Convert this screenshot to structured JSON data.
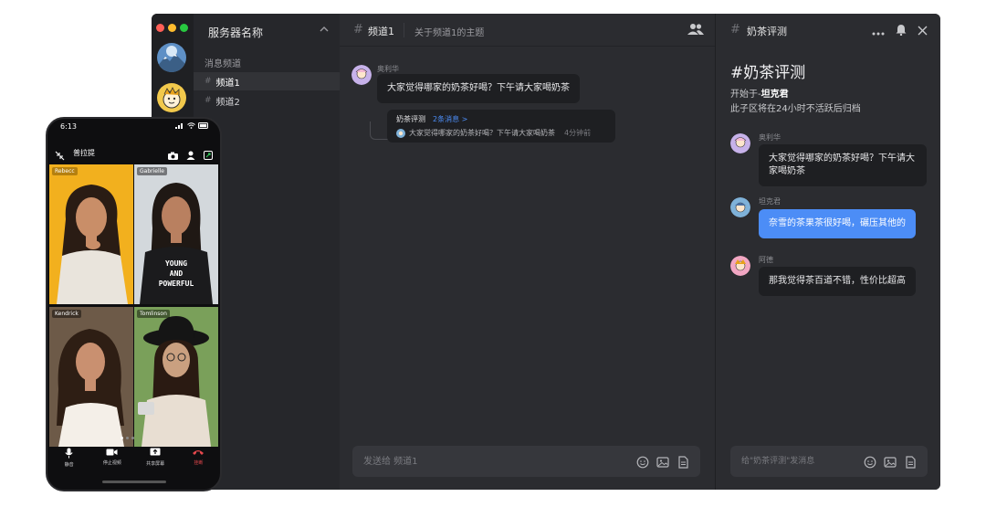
{
  "window": {
    "traffic_lights": [
      "#ff5f57",
      "#febc2e",
      "#28c840"
    ],
    "accent": "#4c8df6"
  },
  "sidebar": {
    "server_name": "服务器名称",
    "group_label": "消息频道",
    "channels": [
      {
        "label": "频道1",
        "active": true
      },
      {
        "label": "频道2",
        "active": false
      }
    ]
  },
  "main": {
    "channel_title": "频道1",
    "topic": "关于频道1的主题",
    "messages": [
      {
        "author": "奥利华",
        "text": "大家觉得哪家的奶茶好喝？下午请大家喝奶茶"
      }
    ],
    "thread_preview": {
      "title": "奶茶评测",
      "count": "2条消息 >",
      "last_message": "大家觉得哪家的奶茶好喝？下午请大家喝奶茶",
      "time": "4分钟前"
    },
    "composer_placeholder": "发送给 频道1"
  },
  "thread": {
    "header_title": "奶茶评测",
    "big_title": "#奶茶评测",
    "started_by_prefix": "开始于-",
    "started_by_name": "坦克君",
    "archive_note": "此子区将在24小时不活跃后归档",
    "messages": [
      {
        "author": "奥利华",
        "text": "大家觉得哪家的奶茶好喝？下午请大家喝奶茶"
      },
      {
        "author": "坦克君",
        "text": "奈雪的茶果茶很好喝，碾压其他的"
      },
      {
        "author": "阿德",
        "text": "那我觉得茶百道不错，性价比超高"
      }
    ],
    "composer_placeholder": "给\"奶茶评测\"发消息"
  },
  "phone": {
    "time": "6:13",
    "call_title": "普拉提",
    "participants": [
      "Rebecc",
      "Gabrielle",
      "Kendrick",
      "Tomlinson"
    ],
    "tile_center_text": [
      "YOUNG",
      "AND",
      "POWERFUL"
    ],
    "buttons": [
      {
        "label": "静音",
        "icon": "mic-icon"
      },
      {
        "label": "停止视频",
        "icon": "video-camera-icon"
      },
      {
        "label": "共享屏幕",
        "icon": "screen-share-icon"
      },
      {
        "label": "挂断",
        "icon": "hang-up-icon"
      }
    ]
  }
}
